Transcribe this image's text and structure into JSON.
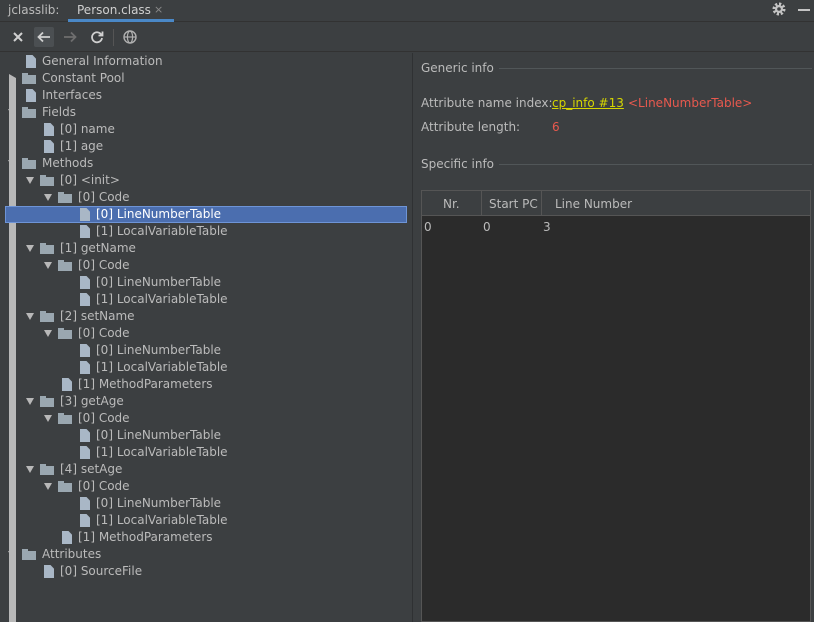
{
  "titlebar": {
    "app_name": "jclasslib:",
    "tab_label": "Person.class",
    "tab_close": "×"
  },
  "toolbar": {
    "buttons": [
      "close-icon",
      "back-arrow-icon",
      "forward-arrow-icon",
      "refresh-icon",
      "globe-icon"
    ]
  },
  "tree": [
    {
      "label": "General Information",
      "level": 0,
      "kind": "file",
      "arrow": "none"
    },
    {
      "label": "Constant Pool",
      "level": 0,
      "kind": "folder",
      "arrow": "right"
    },
    {
      "label": "Interfaces",
      "level": 0,
      "kind": "file",
      "arrow": "none"
    },
    {
      "label": "Fields",
      "level": 0,
      "kind": "folder",
      "arrow": "down"
    },
    {
      "label": "[0] name",
      "level": 1,
      "kind": "file",
      "arrow": "none"
    },
    {
      "label": "[1] age",
      "level": 1,
      "kind": "file",
      "arrow": "none"
    },
    {
      "label": "Methods",
      "level": 0,
      "kind": "folder",
      "arrow": "down"
    },
    {
      "label": "[0] <init>",
      "level": 1,
      "kind": "folder",
      "arrow": "down"
    },
    {
      "label": "[0] Code",
      "level": 2,
      "kind": "folder",
      "arrow": "down"
    },
    {
      "label": "[0] LineNumberTable",
      "level": 3,
      "kind": "file",
      "arrow": "none",
      "selected": true
    },
    {
      "label": "[1] LocalVariableTable",
      "level": 3,
      "kind": "file",
      "arrow": "none"
    },
    {
      "label": "[1] getName",
      "level": 1,
      "kind": "folder",
      "arrow": "down"
    },
    {
      "label": "[0] Code",
      "level": 2,
      "kind": "folder",
      "arrow": "down"
    },
    {
      "label": "[0] LineNumberTable",
      "level": 3,
      "kind": "file",
      "arrow": "none"
    },
    {
      "label": "[1] LocalVariableTable",
      "level": 3,
      "kind": "file",
      "arrow": "none"
    },
    {
      "label": "[2] setName",
      "level": 1,
      "kind": "folder",
      "arrow": "down"
    },
    {
      "label": "[0] Code",
      "level": 2,
      "kind": "folder",
      "arrow": "down"
    },
    {
      "label": "[0] LineNumberTable",
      "level": 3,
      "kind": "file",
      "arrow": "none"
    },
    {
      "label": "[1] LocalVariableTable",
      "level": 3,
      "kind": "file",
      "arrow": "none"
    },
    {
      "label": "[1] MethodParameters",
      "level": 2,
      "kind": "file",
      "arrow": "none"
    },
    {
      "label": "[3] getAge",
      "level": 1,
      "kind": "folder",
      "arrow": "down"
    },
    {
      "label": "[0] Code",
      "level": 2,
      "kind": "folder",
      "arrow": "down"
    },
    {
      "label": "[0] LineNumberTable",
      "level": 3,
      "kind": "file",
      "arrow": "none"
    },
    {
      "label": "[1] LocalVariableTable",
      "level": 3,
      "kind": "file",
      "arrow": "none"
    },
    {
      "label": "[4] setAge",
      "level": 1,
      "kind": "folder",
      "arrow": "down"
    },
    {
      "label": "[0] Code",
      "level": 2,
      "kind": "folder",
      "arrow": "down"
    },
    {
      "label": "[0] LineNumberTable",
      "level": 3,
      "kind": "file",
      "arrow": "none"
    },
    {
      "label": "[1] LocalVariableTable",
      "level": 3,
      "kind": "file",
      "arrow": "none"
    },
    {
      "label": "[1] MethodParameters",
      "level": 2,
      "kind": "file",
      "arrow": "none"
    },
    {
      "label": "Attributes",
      "level": 0,
      "kind": "folder",
      "arrow": "down"
    },
    {
      "label": "[0] SourceFile",
      "level": 1,
      "kind": "file",
      "arrow": "none"
    }
  ],
  "detail": {
    "generic_title": "Generic info",
    "name_index_label": "Attribute name index:",
    "name_index_link": "cp_info #13",
    "name_index_ref": "<LineNumberTable>",
    "length_label": "Attribute length:",
    "length_value": "6",
    "specific_title": "Specific info",
    "table": {
      "columns": [
        "Nr.",
        "Start PC",
        "Line Number"
      ],
      "rows": [
        [
          "0",
          "0",
          "3"
        ]
      ]
    }
  },
  "colors": {
    "background": "#3c3f41",
    "selection": "#4b6eaf",
    "link": "#d6d600",
    "reference": "#e8594e",
    "tab_accent": "#4a88c7"
  }
}
